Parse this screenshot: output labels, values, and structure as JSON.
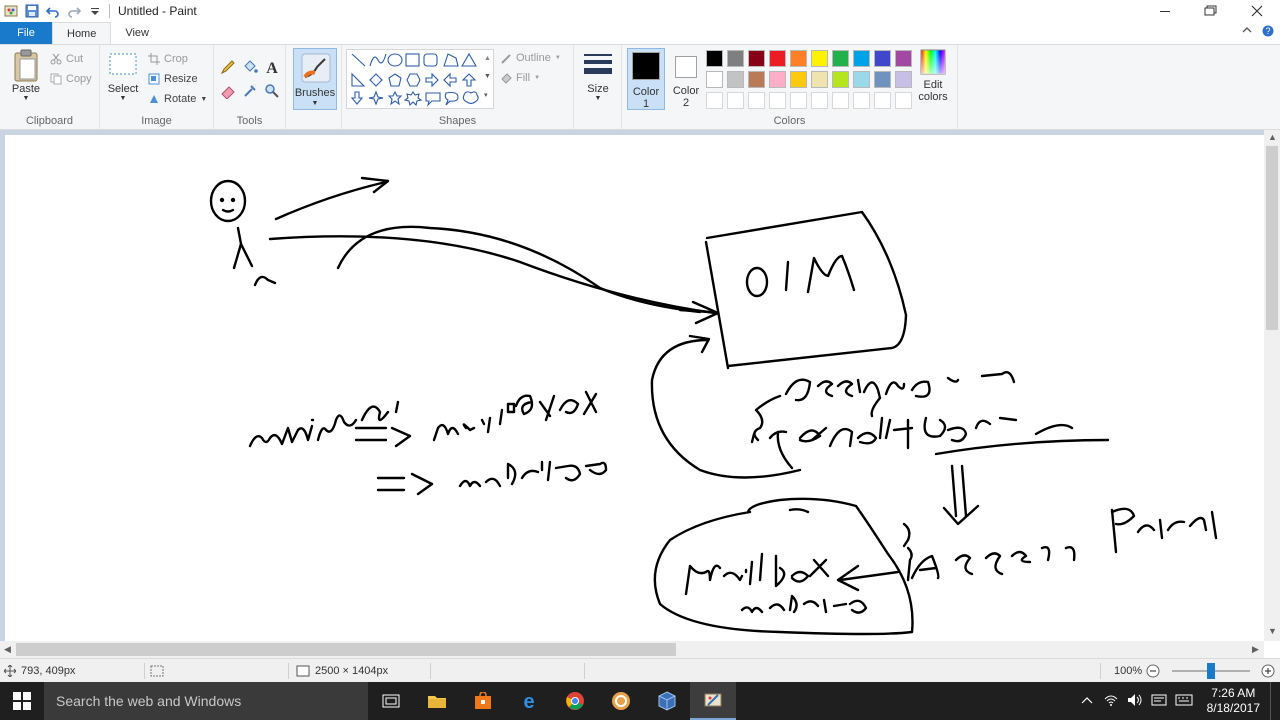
{
  "window": {
    "title": "Untitled - Paint"
  },
  "quick_access": {
    "icons": [
      "paint-app-icon",
      "save-icon",
      "undo-icon",
      "redo-icon",
      "customize-dropdown-icon"
    ]
  },
  "tabs": [
    {
      "label": "File"
    },
    {
      "label": "Home"
    },
    {
      "label": "View"
    }
  ],
  "ribbon": {
    "clipboard": {
      "group_label": "Clipboard",
      "paste": "Paste",
      "cut": "Cut",
      "copy": "Copy"
    },
    "image": {
      "group_label": "Image",
      "select": "Select",
      "crop": "Crop",
      "resize": "Resize",
      "rotate": "Rotate"
    },
    "tools": {
      "group_label": "Tools",
      "icons": [
        "pencil-icon",
        "fill-bucket-icon",
        "text-icon",
        "eraser-icon",
        "color-picker-icon",
        "magnifier-icon"
      ]
    },
    "brushes": {
      "label": "Brushes"
    },
    "shapes": {
      "group_label": "Shapes",
      "outline": "Outline",
      "fill": "Fill"
    },
    "size": {
      "label": "Size"
    },
    "colors": {
      "group_label": "Colors",
      "color1_label": "Color",
      "color1_num": "1",
      "color2_label": "Color",
      "color2_num": "2",
      "color1_value": "#000000",
      "color2_value": "#ffffff",
      "edit_colors": "Edit",
      "edit_colors_2": "colors",
      "palette_row1": [
        "#000000",
        "#7f7f7f",
        "#880015",
        "#ed1c24",
        "#ff7f27",
        "#fff200",
        "#22b14c",
        "#00a2e8",
        "#3f48cc",
        "#a349a4"
      ],
      "palette_row2": [
        "#ffffff",
        "#c3c3c3",
        "#b97a57",
        "#ffaec9",
        "#ffc90e",
        "#efe4b0",
        "#b5e61d",
        "#99d9ea",
        "#7092be",
        "#c8bfe7"
      ],
      "palette_row3": [
        "#ffffff",
        "#ffffff",
        "#ffffff",
        "#ffffff",
        "#ffffff",
        "#ffffff",
        "#ffffff",
        "#ffffff",
        "#ffffff",
        "#ffffff"
      ]
    }
  },
  "canvas": {
    "handwriting": [
      "OIM",
      "minimal",
      "=> mailbox",
      "=> website",
      "Assigning a",
      "default Role",
      "Access Policy",
      "Mailbox",
      "website"
    ]
  },
  "statusbar": {
    "cursor_pos": "793, 409px",
    "image_size": "2500 × 1404px",
    "zoom": "100%",
    "zoom_level_percent": 100
  },
  "taskbar": {
    "search_placeholder": "Search the web and Windows",
    "time": "7:26 AM",
    "date": "8/18/2017"
  }
}
